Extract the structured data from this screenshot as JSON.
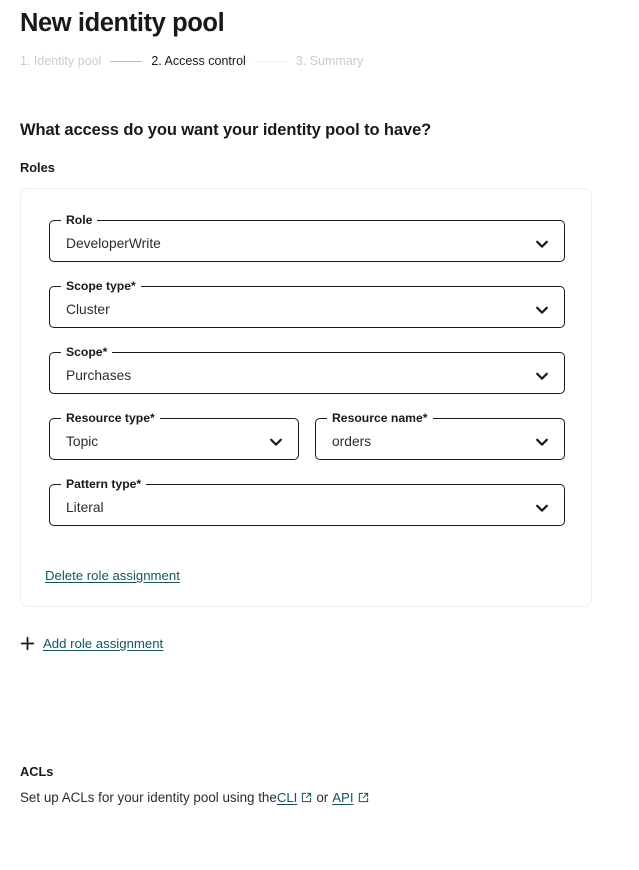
{
  "header": {
    "title": "New identity pool",
    "steps": [
      {
        "label": "1. Identity pool",
        "state": "done"
      },
      {
        "label": "2. Access control",
        "state": "current"
      },
      {
        "label": "3. Summary",
        "state": "upcoming"
      }
    ]
  },
  "main": {
    "question": "What access do you want your identity pool to have?",
    "roles_label": "Roles",
    "role_card": {
      "fields": [
        {
          "name": "role",
          "label": "Role",
          "value": "DeveloperWrite",
          "icon": "chevron-down-icon"
        },
        {
          "name": "scope-type",
          "label": "Scope type*",
          "value": "Cluster",
          "icon": "chevron-down-icon"
        },
        {
          "name": "scope",
          "label": "Scope*",
          "value": "Purchases",
          "icon": "chevron-down-icon"
        },
        {
          "name": "resource-type",
          "label": "Resource type*",
          "value": "Topic",
          "icon": "chevron-down-icon"
        },
        {
          "name": "resource-name",
          "label": "Resource name*",
          "value": "orders",
          "icon": "chevron-down-icon"
        },
        {
          "name": "pattern-type",
          "label": "Pattern type*",
          "value": "Literal",
          "icon": "chevron-down-icon"
        }
      ],
      "delete_link": "Delete role assignment"
    },
    "add_role_link": "Add role assignment",
    "add_role_icon": "plus-icon"
  },
  "acls": {
    "title": "ACLs",
    "text_prefix": "Set up ACLs for your identity pool using the ",
    "cli_link": "CLI",
    "separator": " or ",
    "api_link": "API",
    "external_icon": "external-link-icon"
  },
  "colors": {
    "link": "#16545c",
    "text": "#171a1c",
    "muted": "#c9cccf",
    "border": "#ecedee",
    "field_border": "#171a1c"
  }
}
